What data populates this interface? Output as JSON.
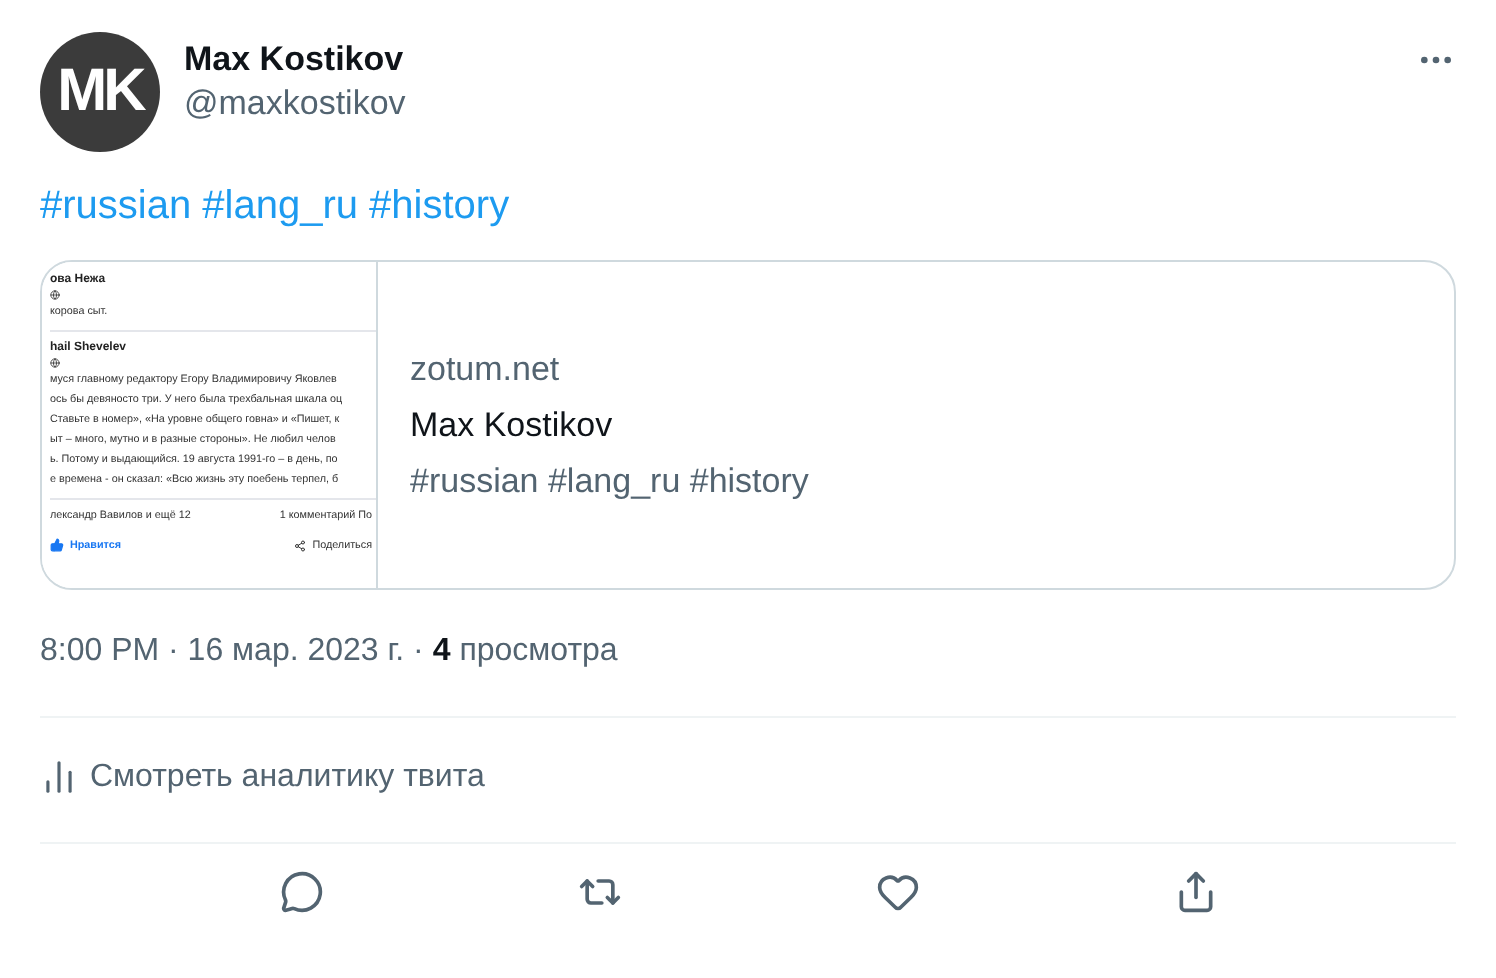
{
  "author": {
    "initials": "MK",
    "name": "Max Kostikov",
    "handle": "@maxkostikov"
  },
  "text": "#russian #lang_ru #history",
  "card": {
    "thumbnail": {
      "posts": [
        {
          "author": "ова Нежа",
          "lines": [
            "корова сыт."
          ]
        },
        {
          "author": "hail Shevelev",
          "lines": [
            "муся главному редактору Егору Владимировичу Яковлев",
            "ось бы девяносто три. У него была трехбальная шкала оц",
            "Ставьте в номер», «На уровне общего говна» и «Пишет, к",
            "ыт – много, мутно и в разные стороны». Не любил челов",
            "ь. Потому и выдающийся. 19 августа 1991-го – в день, по",
            "е времена - он сказал: «Всю жизнь эту поебень терпел, б"
          ]
        }
      ],
      "reactions": "лександр Вавилов и ещё 12",
      "comments": "1 комментарий",
      "comments_cut": "По",
      "like": "Нравится",
      "share": "Поделиться"
    },
    "domain": "zotum.net",
    "title": "Max Kostikov",
    "description": "#russian #lang_ru #history"
  },
  "meta": {
    "time": "8:00 PM · 16 мар. 2023 г. · ",
    "views": "4",
    "views_label": "просмотра"
  },
  "analytics": "Смотреть аналитику твита"
}
